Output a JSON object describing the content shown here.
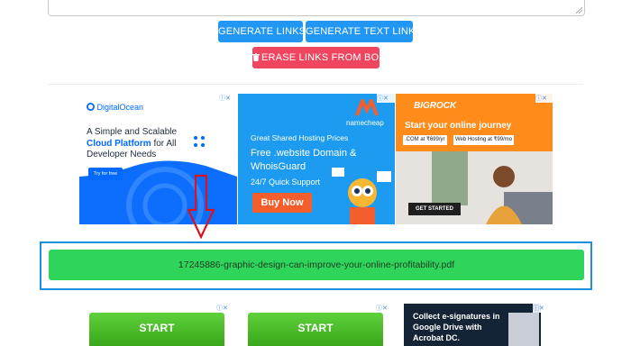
{
  "buttons": {
    "generate_links": "GENERATE LINKS",
    "generate_text_links": "GENERATE TEXT LINKS",
    "erase_links": "ERASE LINKS FROM BOX"
  },
  "ads": {
    "digitalocean": {
      "brand": "DigitalOcean",
      "line1": "A Simple and Scalable",
      "highlight": "Cloud Platform",
      "line2_rest": " for All",
      "line3": "Developer Needs",
      "cta": "Try for free"
    },
    "namecheap": {
      "brand": "namecheap",
      "line1": "Great Shared Hosting Prices",
      "line2": "Free .website Domain &",
      "line3": "WhoisGuard",
      "line4": "24/7 Quick Support",
      "cta": "Buy Now"
    },
    "bigrock": {
      "brand": "BIGROCK",
      "headline": "Start your online journey",
      "tag1": ".COM at ₹699/yr",
      "tag2": "Web Hosting at ₹99/mo",
      "cta": "GET STARTED"
    }
  },
  "file_link": "17245886-graphic-design-can-improve-your-online-profitability.pdf",
  "bottom_ads": {
    "start1": "START",
    "start2": "START",
    "gdrive": "Collect e-signatures in Google Drive with Acrobat DC."
  },
  "colors": {
    "button_blue": "#2196f3",
    "button_red": "#f0455f",
    "file_green": "#2fd55a",
    "frame_blue": "#1e8fe0",
    "arrow_red": "#d9141b"
  }
}
